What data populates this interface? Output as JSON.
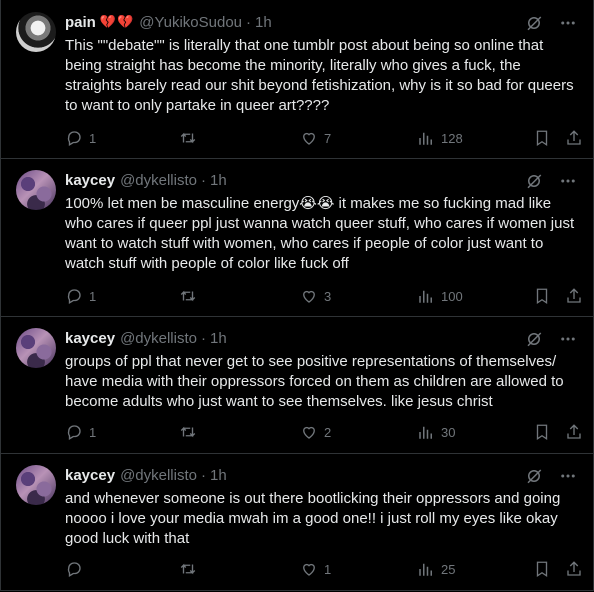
{
  "tweets": [
    {
      "name": "pain",
      "name_hearts": "💔💔",
      "handle": "@YukikoSudou",
      "dot": "·",
      "time": "1h",
      "text": "This \"\"debate\"\" is literally that one tumblr post about being so online that being straight has become the minority, literally who gives a fuck, the straights barely read our shit beyond fetishization, why is it so bad for queers to want to only partake in queer art????",
      "replies": "1",
      "reposts": "",
      "likes": "7",
      "views": "128"
    },
    {
      "name": "kaycey",
      "handle": "@dykellisto",
      "dot": "·",
      "time": "1h",
      "text": "100% let men be masculine energy😭😭 it makes me so fucking mad like who cares if queer ppl just wanna watch queer stuff, who cares if women just want to watch stuff with women, who cares if people of color just want to watch stuff with people of color like fuck off",
      "replies": "1",
      "reposts": "",
      "likes": "3",
      "views": "100"
    },
    {
      "name": "kaycey",
      "handle": "@dykellisto",
      "dot": "·",
      "time": "1h",
      "text": "groups of ppl that never get to see positive representations of themselves/ have media with their oppressors forced on them as children are allowed to become adults who just want to see themselves. like jesus christ",
      "replies": "1",
      "reposts": "",
      "likes": "2",
      "views": "30"
    },
    {
      "name": "kaycey",
      "handle": "@dykellisto",
      "dot": "·",
      "time": "1h",
      "text": "and whenever someone is out there bootlicking their oppressors and going noooo i love your media mwah im a good one!! i just roll my eyes like okay good luck with that",
      "replies": "",
      "reposts": "",
      "likes": "1",
      "views": "25"
    }
  ],
  "icons": {
    "reply": "reply-icon",
    "repost": "repost-icon",
    "like": "like-icon",
    "views": "views-icon",
    "bookmark": "bookmark-icon",
    "share": "share-icon",
    "grok": "grok-icon",
    "more": "more-icon"
  },
  "colors": {
    "background": "#000000",
    "text": "#e7e9ea",
    "muted": "#71767b",
    "border": "#2f3336",
    "heart_break": "#e0245e"
  }
}
